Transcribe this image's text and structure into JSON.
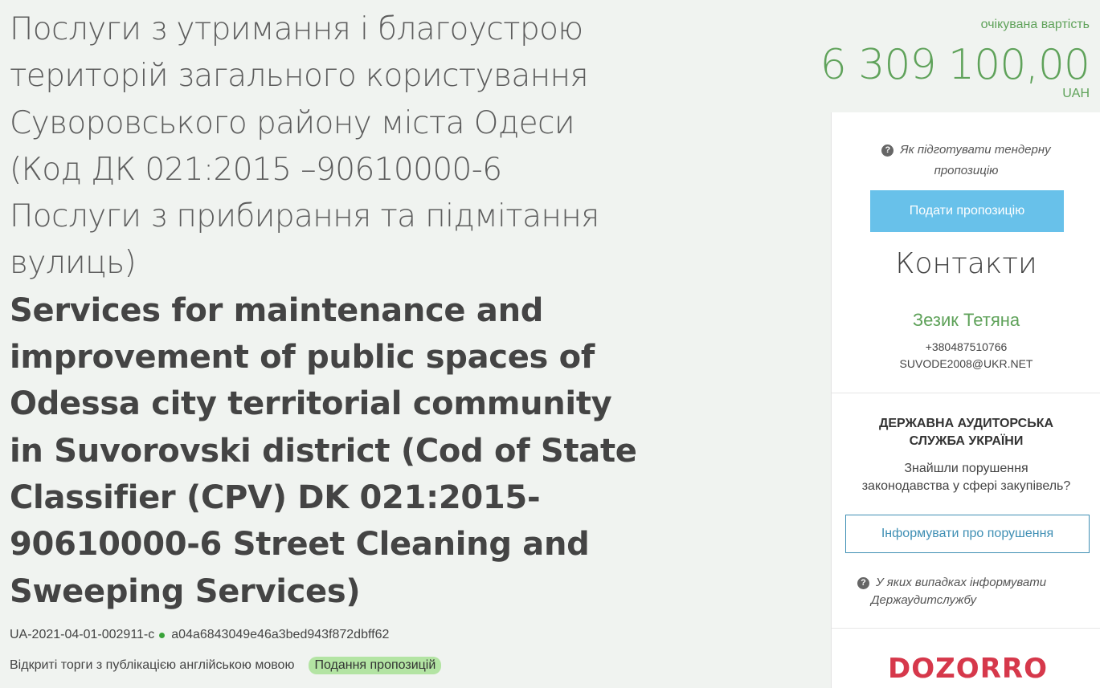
{
  "tender": {
    "title_ua_lines": [
      "Послуги з утримання і благоустрою",
      "територій загального користування",
      "Суворовського району міста Одеси",
      "(Код ДК 021:2015 –90610000-6",
      "Послуги з прибирання та підмітання",
      "вулиць)"
    ],
    "title_en_lines": [
      "Services for maintenance and",
      "improvement of public spaces of",
      "Odessa city territorial community",
      "in Suvorovski district (Cod of State",
      "Classifier (CPV) DK 021:2015-",
      "90610000-6 Street Cleaning and",
      "Sweeping Services)"
    ],
    "tender_id": "UA-2021-04-01-002911-c",
    "hash_id": "a04a6843049e46a3bed943f872dbff62",
    "procedure_type": "Відкриті торги з публікацією англійською мовою",
    "status": "Подання пропозицій"
  },
  "price": {
    "label": "очікувана вартість",
    "value": "6 309 100,00",
    "currency": "UAH"
  },
  "sidebar": {
    "help_line1": "Як підготувати тендерну",
    "help_line2": "пропозицію",
    "submit_label": "Подати пропозицію",
    "contacts_title": "Контакти",
    "contact_name": "Зезик Тетяна",
    "contact_phone": "+380487510766",
    "contact_email": "SUVODE2008@UKR.NET",
    "audit_title_line1": "ДЕРЖАВНА АУДИТОРСЬКА",
    "audit_title_line2": "СЛУЖБА УКРАЇНИ",
    "audit_text_line1": "Знайшли порушення",
    "audit_text_line2": "законодавства у сфері закупівель?",
    "report_label": "Інформувати про порушення",
    "audit_help_line1": "У яких випадках інформувати",
    "audit_help_line2": "Держаудитслужбу",
    "dozorro_logo": "DOZORRO"
  },
  "icons": {
    "help": "question-circle-icon",
    "status_dot": "dot-icon"
  },
  "colors": {
    "accent_green": "#5fa25a",
    "button_blue": "#68c1ea",
    "outline_blue": "#3f8fb4",
    "badge_green": "#b3e4a3",
    "dozorro_red": "#d6384b"
  }
}
